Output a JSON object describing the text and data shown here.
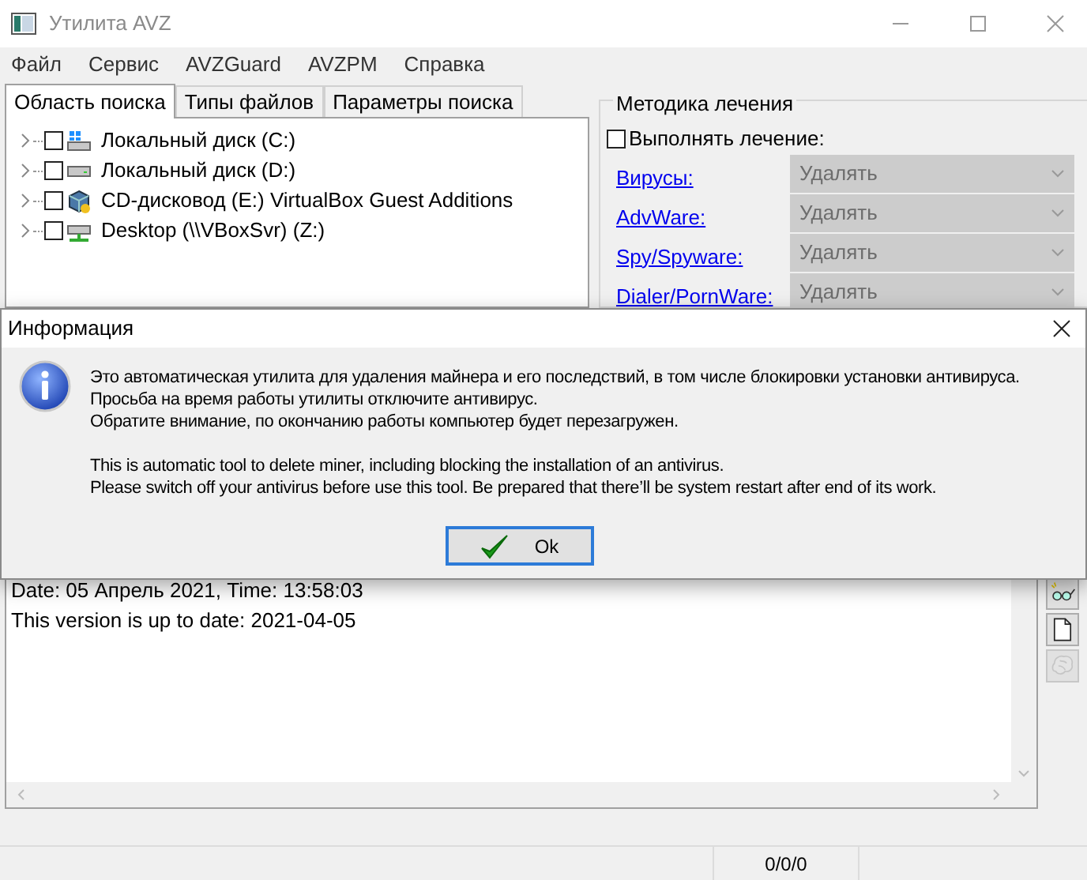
{
  "window": {
    "title": "Утилита AVZ"
  },
  "menu": [
    "Файл",
    "Сервис",
    "AVZGuard",
    "AVZPM",
    "Справка"
  ],
  "tabs": [
    {
      "label": "Область поиска",
      "selected": true
    },
    {
      "label": "Типы файлов",
      "selected": false
    },
    {
      "label": "Параметры поиска",
      "selected": false
    }
  ],
  "tree": [
    {
      "label": "Локальный диск (C:)",
      "kind": "system-disk",
      "checked": false,
      "expanded": false
    },
    {
      "label": "Локальный диск (D:)",
      "kind": "disk",
      "checked": false,
      "expanded": false
    },
    {
      "label": "CD-дисковод (E:) VirtualBox Guest Additions",
      "kind": "cd",
      "checked": false,
      "expanded": false
    },
    {
      "label": "Desktop (\\\\VBoxSvr) (Z:)",
      "kind": "network",
      "checked": false,
      "expanded": false
    }
  ],
  "treatment": {
    "title": "Методика лечения",
    "perform": {
      "label": "Выполнять лечение:",
      "checked": false
    },
    "rows": [
      {
        "label": "Вирусы:",
        "value": "Удалять",
        "disabled": true
      },
      {
        "label": "AdvWare:",
        "value": "Удалять",
        "disabled": true
      },
      {
        "label": "Spy/Spyware:",
        "value": "Удалять",
        "disabled": true
      },
      {
        "label": "Dialer/PornWare:",
        "value": "Удалять",
        "disabled": true
      }
    ]
  },
  "log": [
    "Date: 05 Апрель 2021, Time: 13:58:03",
    "This version is up to date: 2021-04-05"
  ],
  "side_buttons": [
    {
      "kind": "glasses",
      "disabled": false
    },
    {
      "kind": "page",
      "disabled": false
    },
    {
      "kind": "brain",
      "disabled": true
    }
  ],
  "status_bar": [
    "0/0/0"
  ],
  "dialog": {
    "title": "Информация",
    "paragraphs": [
      [
        "Это автоматическая утилита для удаления майнера и его последствий, в том числе блокировки установки антивируса.",
        "Просьба на время работы утилиты отключите антивирус.",
        "Обратите внимание, по окончанию работы компьютер будет перезагружен."
      ],
      [
        "This is automatic tool to delete miner, including blocking the installation of an antivirus.",
        "Please switch off your antivirus before use this tool. Be prepared that there’ll be system restart after end of its work."
      ]
    ],
    "button": "Ok"
  }
}
